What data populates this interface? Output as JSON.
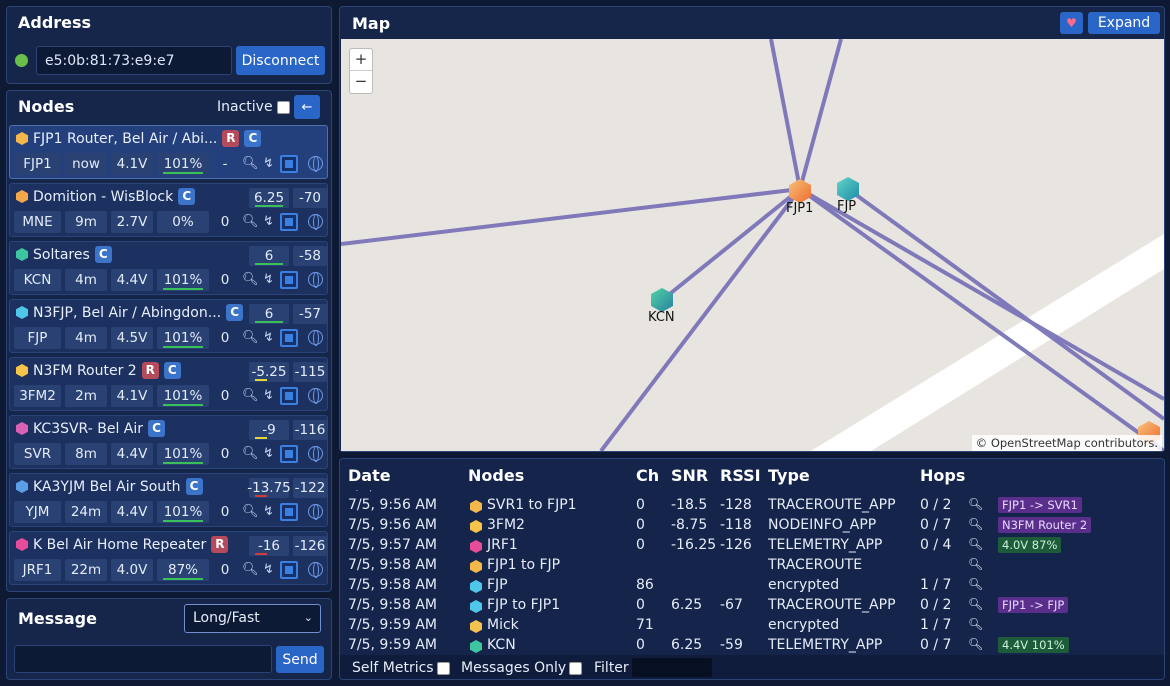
{
  "address": {
    "title": "Address",
    "value": "e5:0b:81:73:e9:e7",
    "disconnect": "Disconnect",
    "status_color": "#6abf4b"
  },
  "nodes_panel": {
    "title": "Nodes",
    "inactive_label": "Inactive",
    "back_icon": "arrow-left-icon"
  },
  "nodes": [
    {
      "name": "FJP1 Router, Bel Air / Abi...",
      "tags": [
        "R",
        "C"
      ],
      "short": "FJP1",
      "time": "now",
      "volt": "4.1V",
      "batt": "101%",
      "count": "-",
      "snr": "",
      "rssi": "",
      "hex": "#f4b84a",
      "selected": true
    },
    {
      "name": "Domition - WisBlock",
      "tags": [
        "C"
      ],
      "short": "MNE",
      "time": "9m",
      "volt": "2.7V",
      "batt": "0%",
      "count": "0",
      "snr": "6.25",
      "rssi": "-70",
      "hex": "#f2a94a"
    },
    {
      "name": "Soltares",
      "tags": [
        "C"
      ],
      "short": "KCN",
      "time": "4m",
      "volt": "4.4V",
      "batt": "101%",
      "count": "0",
      "snr": "6",
      "rssi": "-58",
      "hex": "#3ec6a0"
    },
    {
      "name": "N3FJP, Bel Air / Abingdon...",
      "tags": [
        "C"
      ],
      "short": "FJP",
      "time": "4m",
      "volt": "4.5V",
      "batt": "101%",
      "count": "0",
      "snr": "6",
      "rssi": "-57",
      "hex": "#4fc7e8"
    },
    {
      "name": "N3FM Router 2",
      "tags": [
        "R",
        "C"
      ],
      "short": "3FM2",
      "time": "2m",
      "volt": "4.1V",
      "batt": "101%",
      "count": "0",
      "snr": "-5.25",
      "rssi": "-115",
      "hex": "#f7c348"
    },
    {
      "name": "KC3SVR- Bel Air",
      "tags": [
        "C"
      ],
      "short": "SVR",
      "time": "8m",
      "volt": "4.4V",
      "batt": "101%",
      "count": "0",
      "snr": "-9",
      "rssi": "-116",
      "hex": "#d962b5"
    },
    {
      "name": "KA3YJM Bel Air South",
      "tags": [
        "C"
      ],
      "short": "YJM",
      "time": "24m",
      "volt": "4.4V",
      "batt": "101%",
      "count": "0",
      "snr": "-13.75",
      "rssi": "-122",
      "hex": "#5b9de8"
    },
    {
      "name": "K Bel Air Home Repeater",
      "tags": [
        "R"
      ],
      "short": "JRF1",
      "time": "22m",
      "volt": "4.0V",
      "batt": "87%",
      "count": "0",
      "snr": "-16",
      "rssi": "-126",
      "hex": "#e64c9a"
    }
  ],
  "message": {
    "title": "Message",
    "preset": "Long/Fast",
    "send": "Send"
  },
  "map": {
    "title": "Map",
    "expand": "Expand",
    "heart_icon": "heart-icon",
    "zoom_in": "+",
    "zoom_out": "−",
    "attribution": "© OpenStreetMap contributors.",
    "labels": {
      "fjp1": "FJP1",
      "fjp": "FJP",
      "kcn": "KCN"
    }
  },
  "log": {
    "headers": {
      "date": "Date",
      "nodes": "Nodes",
      "ch": "Ch",
      "snr": "SNR",
      "rssi": "RSSI",
      "type": "Type",
      "hops": "Hops"
    },
    "rows": [
      {
        "date": "7/5, 9:56 AM",
        "nodes": "SVR1 to FJP1",
        "ch": "0",
        "snr": "-18.5",
        "rssi": "-128",
        "type": "TRACEROUTE_APP",
        "hops": "0 / 2",
        "pill": "FJP1 -> SVR1",
        "pill_kind": "purple",
        "hex": "#f4b84a"
      },
      {
        "date": "7/5, 9:56 AM",
        "nodes": "3FM2",
        "ch": "0",
        "snr": "-8.75",
        "rssi": "-118",
        "type": "NODEINFO_APP",
        "hops": "0 / 7",
        "pill": "N3FM Router 2",
        "pill_kind": "purple",
        "hex": "#f7c348"
      },
      {
        "date": "7/5, 9:57 AM",
        "nodes": "JRF1",
        "ch": "0",
        "snr": "-16.25",
        "rssi": "-126",
        "type": "TELEMETRY_APP",
        "hops": "0 / 4",
        "pill": "4.0V 87%",
        "pill_kind": "green",
        "hex": "#e64c9a"
      },
      {
        "date": "7/5, 9:58 AM",
        "nodes": "FJP1 to FJP",
        "ch": "",
        "snr": "",
        "rssi": "",
        "type": "TRACEROUTE",
        "hops": "",
        "pill": "",
        "pill_kind": "",
        "hex": "#f4b84a"
      },
      {
        "date": "7/5, 9:58 AM",
        "nodes": "FJP",
        "ch": "86",
        "snr": "",
        "rssi": "",
        "type": "encrypted",
        "hops": "1 / 7",
        "pill": "",
        "pill_kind": "",
        "hex": "#4fc7e8"
      },
      {
        "date": "7/5, 9:58 AM",
        "nodes": "FJP to FJP1",
        "ch": "0",
        "snr": "6.25",
        "rssi": "-67",
        "type": "TRACEROUTE_APP",
        "hops": "0 / 2",
        "pill": "FJP1 -> FJP",
        "pill_kind": "purple",
        "hex": "#4fc7e8"
      },
      {
        "date": "7/5, 9:59 AM",
        "nodes": "Mick",
        "ch": "71",
        "snr": "",
        "rssi": "",
        "type": "encrypted",
        "hops": "1 / 7",
        "pill": "",
        "pill_kind": "",
        "hex": "#f2c14e"
      },
      {
        "date": "7/5, 9:59 AM",
        "nodes": "KCN",
        "ch": "0",
        "snr": "6.25",
        "rssi": "-59",
        "type": "TELEMETRY_APP",
        "hops": "0 / 7",
        "pill": "4.4V 101%",
        "pill_kind": "green",
        "hex": "#3ec6a0"
      }
    ],
    "footer": {
      "self_metrics": "Self Metrics",
      "messages_only": "Messages Only",
      "filter": "Filter"
    }
  }
}
